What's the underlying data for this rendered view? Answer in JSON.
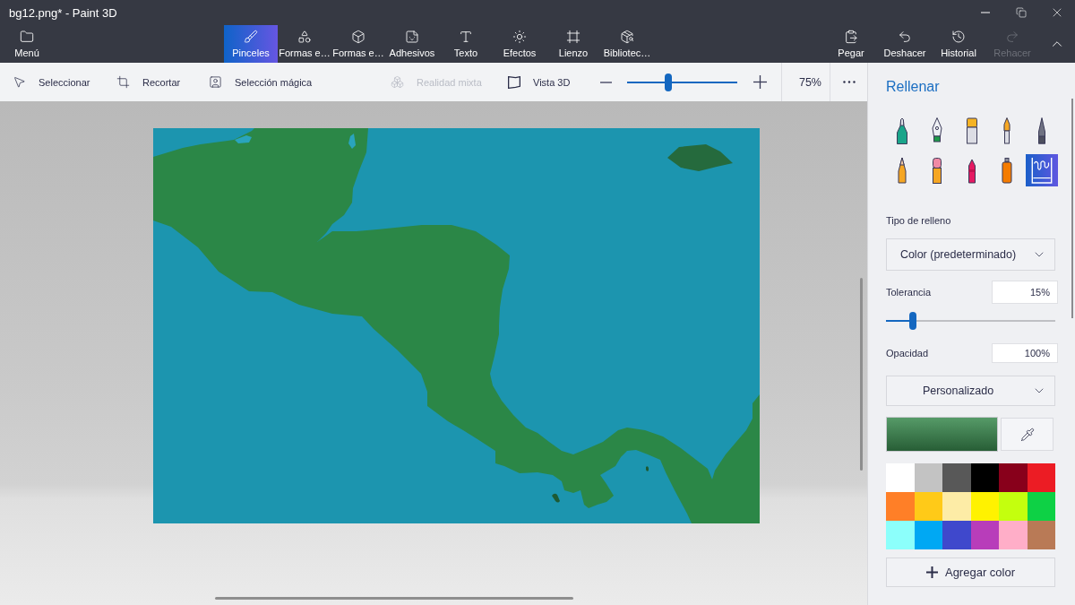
{
  "window": {
    "title": "bg12.png* - Paint 3D"
  },
  "ribbon": {
    "menu": {
      "label": "Menú"
    },
    "tabs": [
      {
        "label": "Pinceles",
        "selected": true
      },
      {
        "label": "Formas e…",
        "selected": false
      },
      {
        "label": "Formas e…",
        "selected": false
      },
      {
        "label": "Adhesivos",
        "selected": false
      },
      {
        "label": "Texto",
        "selected": false
      },
      {
        "label": "Efectos",
        "selected": false
      },
      {
        "label": "Lienzo",
        "selected": false
      },
      {
        "label": "Bibliotec…",
        "selected": false
      }
    ],
    "actions": [
      {
        "label": "Pegar",
        "disabled": false
      },
      {
        "label": "Deshacer",
        "disabled": false
      },
      {
        "label": "Historial",
        "disabled": false
      },
      {
        "label": "Rehacer",
        "disabled": true
      }
    ]
  },
  "toolbar": {
    "tools": [
      {
        "label": "Seleccionar",
        "disabled": false
      },
      {
        "label": "Recortar",
        "disabled": false
      },
      {
        "label": "Selección mágica",
        "disabled": false
      },
      {
        "label": "Realidad mixta",
        "disabled": true
      },
      {
        "label": "Vista 3D",
        "disabled": false
      }
    ],
    "zoom": {
      "level": 0.37,
      "value": "75%"
    }
  },
  "panel": {
    "title": "Rellenar",
    "brushes": [
      {
        "kind": "marker",
        "selected": false
      },
      {
        "kind": "pen",
        "selected": false
      },
      {
        "kind": "flatbrush",
        "selected": false
      },
      {
        "kind": "roundbrush",
        "selected": false
      },
      {
        "kind": "stylus",
        "selected": false
      },
      {
        "kind": "pencil",
        "selected": false
      },
      {
        "kind": "eraser",
        "selected": false
      },
      {
        "kind": "crayon",
        "selected": false
      },
      {
        "kind": "spray",
        "selected": false
      },
      {
        "kind": "fill",
        "selected": true
      }
    ],
    "fill_type": {
      "label": "Tipo de relleno",
      "value": "Color (predeterminado)"
    },
    "tolerance": {
      "label": "Tolerancia",
      "value": "15%",
      "level": 0.16
    },
    "opacity": {
      "label": "Opacidad",
      "value": "100%"
    },
    "color_mode": {
      "value": "Personalizado"
    },
    "current_color": {
      "color": "#3a8a4f"
    },
    "palette": [
      {
        "color": "#ffffff"
      },
      {
        "color": "#c3c3c3"
      },
      {
        "color": "#585858"
      },
      {
        "color": "#000000"
      },
      {
        "color": "#88001b"
      },
      {
        "color": "#ec1c24"
      },
      {
        "color": "#ff7f27"
      },
      {
        "color": "#ffca18"
      },
      {
        "color": "#fdeca6"
      },
      {
        "color": "#fff200"
      },
      {
        "color": "#c4ff0e"
      },
      {
        "color": "#0ed145"
      },
      {
        "color": "#8cfffb"
      },
      {
        "color": "#00a8f3"
      },
      {
        "color": "#3f48cc"
      },
      {
        "color": "#b83dba"
      },
      {
        "color": "#ffaec8"
      },
      {
        "color": "#b97a56"
      }
    ],
    "add_color": {
      "label": "Agregar color"
    }
  }
}
